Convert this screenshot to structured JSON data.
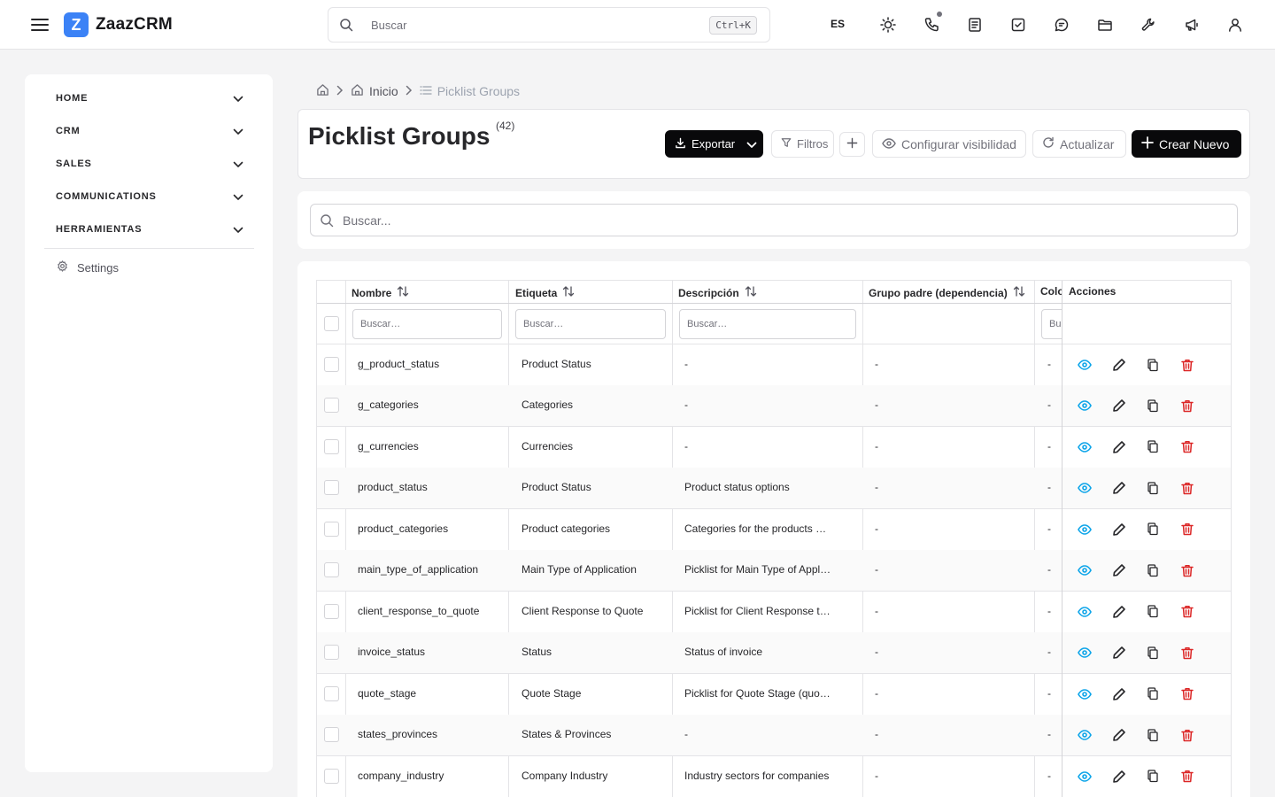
{
  "app": {
    "name": "ZaazCRM",
    "logo_letter": "Z"
  },
  "topbar": {
    "search_placeholder": "Buscar",
    "shortcut": "Ctrl+K",
    "language": "ES",
    "icons": [
      "sun-icon",
      "phone-icon",
      "notes-icon",
      "tasks-icon",
      "chat-icon",
      "folder-icon",
      "tools-icon",
      "megaphone-icon",
      "user-icon"
    ]
  },
  "sidebar": {
    "items": [
      {
        "label": "HOME"
      },
      {
        "label": "CRM"
      },
      {
        "label": "SALES"
      },
      {
        "label": "COMMUNICATIONS"
      },
      {
        "label": "HERRAMIENTAS"
      }
    ],
    "settings_label": "Settings"
  },
  "breadcrumb": {
    "home": "Inicio",
    "current": "Picklist Groups"
  },
  "page": {
    "title": "Picklist Groups",
    "count": "(42)",
    "buttons": {
      "export": "Exportar",
      "filters": "Filtros",
      "visibility": "Configurar visibilidad",
      "refresh": "Actualizar",
      "create": "Crear Nuevo"
    },
    "search_placeholder": "Buscar..."
  },
  "table": {
    "columns": {
      "name": "Nombre",
      "label": "Etiqueta",
      "description": "Descripción",
      "parent": "Grupo padre (dependencia)",
      "color": "Colo",
      "actions": "Acciones"
    },
    "filter_placeholder": "Buscar…",
    "color_filter_placeholder": "Bu",
    "rows": [
      {
        "name": "g_product_status",
        "label": "Product Status",
        "description": "-",
        "parent": "-",
        "color": "-"
      },
      {
        "name": "g_categories",
        "label": "Categories",
        "description": "-",
        "parent": "-",
        "color": "-"
      },
      {
        "name": "g_currencies",
        "label": "Currencies",
        "description": "-",
        "parent": "-",
        "color": "-"
      },
      {
        "name": "product_status",
        "label": "Product Status",
        "description": "Product status options",
        "parent": "-",
        "color": "-"
      },
      {
        "name": "product_categories",
        "label": "Product categories",
        "description": "Categories for the products …",
        "parent": "-",
        "color": "-"
      },
      {
        "name": "main_type_of_application",
        "label": "Main Type of Application",
        "description": "Picklist for Main Type of Appl…",
        "parent": "-",
        "color": "-"
      },
      {
        "name": "client_response_to_quote",
        "label": "Client Response to Quote",
        "description": "Picklist for Client Response t…",
        "parent": "-",
        "color": "-"
      },
      {
        "name": "invoice_status",
        "label": "Status",
        "description": "Status of invoice",
        "parent": "-",
        "color": "-"
      },
      {
        "name": "quote_stage",
        "label": "Quote Stage",
        "description": "Picklist for Quote Stage (quo…",
        "parent": "-",
        "color": "-"
      },
      {
        "name": "states_provinces",
        "label": "States & Provinces",
        "description": "-",
        "parent": "-",
        "color": "-"
      },
      {
        "name": "company_industry",
        "label": "Company Industry",
        "description": "Industry sectors for companies",
        "parent": "-",
        "color": "-"
      }
    ]
  },
  "colors": {
    "accent": "#3b82f6",
    "view": "#0ea5e9",
    "delete": "#dc2626",
    "dark": "#09090b"
  }
}
